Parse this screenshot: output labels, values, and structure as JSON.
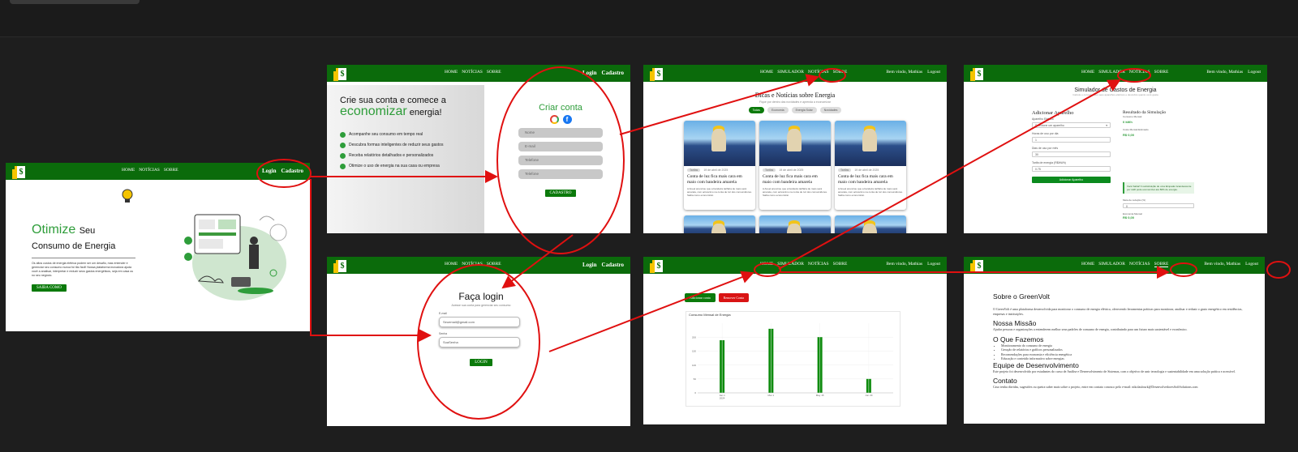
{
  "brand_glyph": "$",
  "nav_public": [
    "HOME",
    "NOTÍCIAS",
    "SOBRE"
  ],
  "nav_user": [
    "HOME",
    "SIMULADOR",
    "NOTÍCIAS",
    "SOBRE"
  ],
  "auth": {
    "login": "Login",
    "signup": "Cadastro"
  },
  "user": {
    "greeting": "Bem vindo, Mathias",
    "logout": "Logout"
  },
  "home": {
    "title_accent": "Otimize",
    "title_rest_1": "Seu",
    "title_rest_2": "Consumo de Energia",
    "paragraph": "Os altos custos de energia elétrica podem ser um desafio, mas entender e gerenciar seu consumo nunca foi tão fácil! Nossa plataforma inovadora ajuda você a analisar, interpretar e reduzir seus gastos energéticos, seja em casa ou no seu negócio.",
    "cta": "SAIBA COMO"
  },
  "signup": {
    "headline_1": "Crie sua conta e comece a",
    "headline_accent": "economizar",
    "headline_2": "energia!",
    "benefits": [
      "Acompanhe seu consumo em tempo real",
      "Descubra formas inteligentes de reduzir seus gastos",
      "Receba relatórios detalhados e personalizados",
      "Otimize o uso de energia na sua casa ou empresa"
    ],
    "form_title": "Criar conta",
    "fields": [
      "Nome",
      "E-mail",
      "Telefone",
      "Telefone"
    ],
    "submit": "CADASTRO"
  },
  "login": {
    "title": "Faça login",
    "subtitle": "Acesse sua conta para gerenciar seu consumo",
    "email_label": "E-mail",
    "email_value": "Seuemail@gmail.com",
    "password_label": "Senha",
    "password_value": "SuaSenha",
    "submit": "LOGIN"
  },
  "news": {
    "title": "Dicas e Notícias sobre Energia",
    "subtitle": "Fique por dentro das novidades e aprenda a economizar",
    "filters": [
      "Todas",
      "Economia",
      "Energia Solar",
      "Novidades"
    ],
    "cards": [
      {
        "tag": "Tarifas",
        "date": "19 de abril de 2025",
        "title": "Conta de luz fica mais cara em maio com bandeira amarela",
        "text": "A Aneel anunciou que a bandeira tarifária de maio será amarela, com acréscimo na conta de luz dos consumidores. Saiba como economizar."
      },
      {
        "tag": "Tarifas",
        "date": "19 de abril de 2025",
        "title": "Conta de luz fica mais cara em maio com bandeira amarela",
        "text": "A Aneel anunciou que a bandeira tarifária de maio será amarela, com acréscimo na conta de luz dos consumidores. Saiba como economizar."
      },
      {
        "tag": "Tarifas",
        "date": "19 de abril de 2025",
        "title": "Conta de luz fica mais cara em maio com bandeira amarela",
        "text": "A Aneel anunciou que a bandeira tarifária de maio será amarela, com acréscimo na conta de luz dos consumidores. Saiba como economizar."
      }
    ]
  },
  "simulator": {
    "title": "Simulador de Gastos de Energia",
    "subtitle": "Calcule o consumo dos seus aparelhos elétricos e descubra quanto você gasta",
    "add_title": "Adicionar Aparelho",
    "device_label": "Aparelho Elétrico",
    "device_value": "Selecione um aparelho",
    "hours_label": "Horas de uso por dia",
    "hours_value": "1",
    "days_label": "Dias de uso por mês",
    "days_value": "30",
    "rate_label": "Tarifa de energia (R$/kWh)",
    "rate_value": "0.75",
    "add_button": "Adicionar Aparelho",
    "result_title": "Resultado da Simulação",
    "consumption_label": "Consumo Mensal",
    "consumption_value": "0 kWh",
    "cost_label": "Custo Mensal Estimado",
    "cost_value": "R$ 0,00",
    "tip": "Você Sabia? A substituição de uma lâmpada incandescente por LED pode economizar até 80% de energia.",
    "meta_label": "Meta de redução (%)",
    "meta_value": "0",
    "savings_label": "Economia Mensal",
    "savings_value": "R$ 0,00"
  },
  "dashboard": {
    "add_button": "Adicionar conta",
    "remove_button": "Remover Conta"
  },
  "chart_data": {
    "type": "bar",
    "title": "Consumo Mensal de Energia",
    "categories": [
      "Jan 1\n2024",
      "Mar 1",
      "May 15",
      "Jun 29"
    ],
    "values": [
      189,
      230,
      200,
      50
    ],
    "ylim": [
      0,
      250
    ],
    "yticks": [
      0,
      50,
      100,
      150,
      200
    ],
    "color": "#0f8c0f",
    "grid": true
  },
  "about": {
    "title": "Sobre o GreenVolt",
    "intro": "O GreenVolt é uma plataforma desenvolvida para monitorar o consumo de energia elétrica, oferecendo ferramentas práticas para monitorar, analisar e reduzir o gasto energético em residências, empresas e instituições.",
    "mission_title": "Nossa Missão",
    "mission_text": "Ajudar pessoas e organizações a entenderem melhor seus padrões de consumo de energia, contribuindo para um futuro mais sustentável e econômico.",
    "what_title": "O Que Fazemos",
    "what_items": [
      "Monitoramento do consumo de energia",
      "Geração de relatórios e gráficos personalizados",
      "Recomendações para economia e eficiência energética",
      "Educação e conteúdo informativo sobre energias"
    ],
    "team_title": "Equipe de Desenvolvimento",
    "team_text": "Este projeto foi desenvolvido por estudantes do curso de Análise e Desenvolvimento de Sistemas, com o objetivo de unir tecnologia e sustentabilidade em uma solução prática e acessível.",
    "contact_title": "Contato",
    "contact_text": "Caso tenha dúvidas, sugestões ou queira saber mais sobre o projeto, entre em contato conosco pelo e-mail: nikolasfourk@DesenvolvedoresSoftSolutions.com"
  },
  "colors": {
    "brand_green": "#0b6b0b",
    "accent_green": "#2e9d3a",
    "annotation_red": "#e01010",
    "canvas": "#1e1e1e"
  }
}
